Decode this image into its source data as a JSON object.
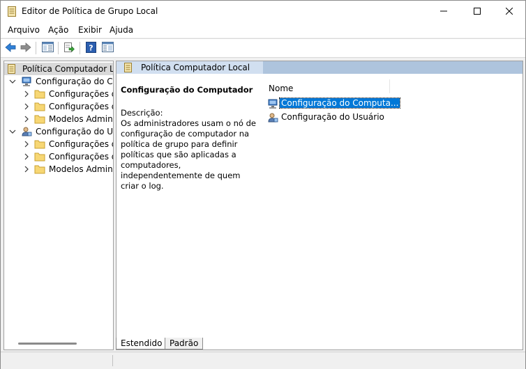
{
  "window": {
    "title": "Editor de Política de Grupo Local",
    "minimize_glyph": "—",
    "maximize_glyph": "☐",
    "close_glyph": "✕"
  },
  "menu": {
    "items": [
      "Arquivo",
      "Ação",
      "Exibir",
      "Ajuda"
    ]
  },
  "toolbar": {
    "icons": [
      "back-arrow-icon",
      "forward-arrow-icon",
      "show-hide-tree-icon",
      "export-list-icon",
      "help-icon",
      "properties-view-icon"
    ]
  },
  "tree": {
    "root": "Política Computador Local",
    "nodes": [
      {
        "label": "Configuração do Computador",
        "icon": "computer-config-icon",
        "expanded": true,
        "children": [
          "Configurações de Software",
          "Configurações do Windows",
          "Modelos Administrativos"
        ]
      },
      {
        "label": "Configuração do Usuário",
        "icon": "user-config-icon",
        "expanded": true,
        "children": [
          "Configurações de Software",
          "Configurações do Windows",
          "Modelos Administrativos"
        ]
      }
    ]
  },
  "main": {
    "banner_title": "Política Computador Local",
    "description_title": "Configuração do Computador",
    "description_label": "Descrição:",
    "description_text": "Os administradores usam o nó de configuração de computador na política de grupo para definir políticas que são aplicadas a computadores, independentemente de quem criar o log.",
    "column_header": "Nome",
    "items": [
      {
        "label": "Configuração do Computa...",
        "icon": "computer-config-icon",
        "selected": true
      },
      {
        "label": "Configuração do Usuário",
        "icon": "user-config-icon",
        "selected": false
      }
    ]
  },
  "tabs": [
    {
      "label": "Estendido",
      "active": true
    },
    {
      "label": "Padrão",
      "active": false
    }
  ],
  "colors": {
    "selection": "#0078d7",
    "banner": "#aec4dd",
    "banner_tab": "#d1dff0",
    "tree_root_highlight": "#d9d9d9"
  }
}
